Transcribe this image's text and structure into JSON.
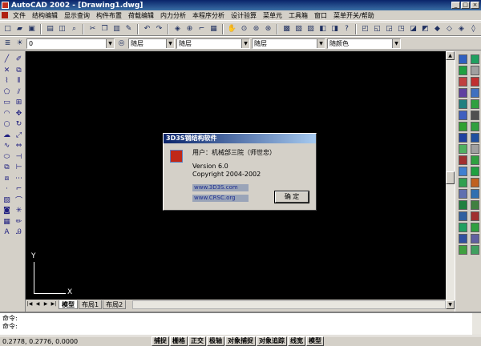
{
  "window": {
    "title": "AutoCAD 2002 - [Drawing1.dwg]"
  },
  "menu": {
    "items": [
      "文件",
      "结构编辑",
      "显示查询",
      "构件布置",
      "荷载编辑",
      "内力分析",
      "本程序分析",
      "设计验算",
      "菜单元",
      "工具箱",
      "窗口",
      "菜单开关/帮助"
    ]
  },
  "properties_bar": {
    "layer": "0",
    "color": "随层",
    "linetype": "随层",
    "lineweight": "随层",
    "plotstyle": "随颜色"
  },
  "drawing": {
    "ucs_y": "Y",
    "ucs_x": "X"
  },
  "layout_tabs": [
    "模型",
    "布局1",
    "布局2"
  ],
  "command": {
    "line1": "命令:",
    "line2": "命令:"
  },
  "status": {
    "coords": "0.2778, 0.2776, 0.0000",
    "buttons": [
      "捕捉",
      "栅格",
      "正交",
      "极轴",
      "对象捕捉",
      "对象追踪",
      "线宽",
      "模型"
    ]
  },
  "dialog": {
    "title": "3D3S钢结构软件",
    "user": "用户：机械部三院（师世忠）",
    "version": "Version 6.0",
    "copyright": "Copyright 2004-2002",
    "link1": "www.3D3S.com",
    "link2": "www.CRSC.org",
    "ok": "确 定"
  },
  "colors": {
    "canvas": "#000000",
    "titlebar": "#0a246a",
    "dialog_face": "#d4d0c8"
  }
}
